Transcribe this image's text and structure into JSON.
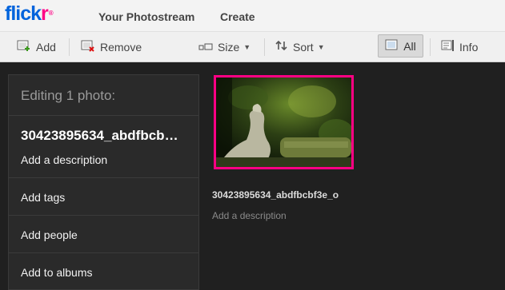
{
  "logo": {
    "text_main": "flick",
    "text_accent": "r",
    "tm": "®"
  },
  "nav": {
    "photostream": "Your Photostream",
    "create": "Create"
  },
  "toolbar": {
    "add": "Add",
    "remove": "Remove",
    "size": "Size",
    "sort": "Sort",
    "all": "All",
    "info": "Info"
  },
  "panel": {
    "title": "Editing 1 photo:",
    "photo_name": "30423895634_abdfbcb…",
    "add_description": "Add a description",
    "add_tags": "Add tags",
    "add_people": "Add people",
    "add_albums": "Add to albums"
  },
  "photo": {
    "title": "30423895634_abdfbcbf3e_o",
    "description_placeholder": "Add a description"
  },
  "colors": {
    "accent_pink": "#ff0084",
    "brand_blue": "#0063dc"
  }
}
